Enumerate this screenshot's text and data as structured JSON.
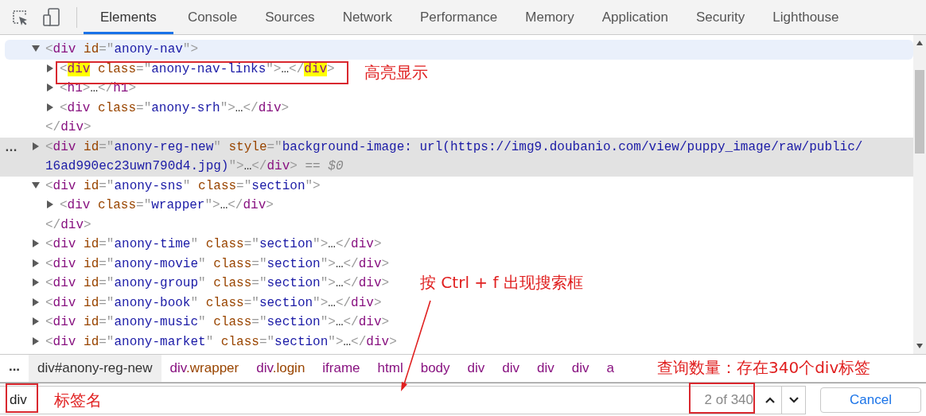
{
  "toolbar": {
    "tabs": [
      {
        "label": "Elements",
        "selected": true
      },
      {
        "label": "Console",
        "selected": false
      },
      {
        "label": "Sources",
        "selected": false
      },
      {
        "label": "Network",
        "selected": false
      },
      {
        "label": "Performance",
        "selected": false
      },
      {
        "label": "Memory",
        "selected": false
      },
      {
        "label": "Application",
        "selected": false
      },
      {
        "label": "Security",
        "selected": false
      },
      {
        "label": "Lighthouse",
        "selected": false
      }
    ]
  },
  "tree": [
    {
      "expanded": true,
      "hovered": true,
      "selected": false,
      "open": [
        {
          "kind": "punct",
          "text": "<"
        },
        {
          "kind": "tag",
          "text": "div"
        },
        {
          "kind": "attr",
          "text": " id"
        },
        {
          "kind": "punct",
          "text": "=\""
        },
        {
          "kind": "value",
          "text": "anony-nav"
        },
        {
          "kind": "punct",
          "text": "\">"
        }
      ],
      "children": [
        {
          "expanded": false,
          "hovered": false,
          "selected": false,
          "open": [
            {
              "kind": "punct",
              "text": "<"
            },
            {
              "kind": "match",
              "text": "div"
            },
            {
              "kind": "attr",
              "text": " class"
            },
            {
              "kind": "punct",
              "text": "=\""
            },
            {
              "kind": "value",
              "text": "anony-nav-links"
            },
            {
              "kind": "punct",
              "text": "\">"
            },
            {
              "kind": "text",
              "text": "…"
            },
            {
              "kind": "punct",
              "text": "</"
            },
            {
              "kind": "match",
              "text": "div"
            },
            {
              "kind": "punct",
              "text": ">"
            }
          ]
        },
        {
          "expanded": false,
          "hovered": false,
          "selected": false,
          "open": [
            {
              "kind": "punct",
              "text": "<"
            },
            {
              "kind": "tag",
              "text": "h1"
            },
            {
              "kind": "punct",
              "text": ">"
            },
            {
              "kind": "text",
              "text": "…"
            },
            {
              "kind": "punct",
              "text": "</"
            },
            {
              "kind": "tag",
              "text": "h1"
            },
            {
              "kind": "punct",
              "text": ">"
            }
          ]
        },
        {
          "expanded": false,
          "hovered": false,
          "selected": false,
          "open": [
            {
              "kind": "punct",
              "text": "<"
            },
            {
              "kind": "tag",
              "text": "div"
            },
            {
              "kind": "attr",
              "text": " class"
            },
            {
              "kind": "punct",
              "text": "=\""
            },
            {
              "kind": "value",
              "text": "anony-srh"
            },
            {
              "kind": "punct",
              "text": "\">"
            },
            {
              "kind": "text",
              "text": "…"
            },
            {
              "kind": "punct",
              "text": "</"
            },
            {
              "kind": "tag",
              "text": "div"
            },
            {
              "kind": "punct",
              "text": ">"
            }
          ]
        }
      ],
      "close": [
        {
          "kind": "punct",
          "text": "</"
        },
        {
          "kind": "tag",
          "text": "div"
        },
        {
          "kind": "punct",
          "text": ">"
        }
      ]
    },
    {
      "expanded": false,
      "hovered": false,
      "selected": true,
      "menu": "…",
      "open": [
        {
          "kind": "punct",
          "text": "<"
        },
        {
          "kind": "tag",
          "text": "div"
        },
        {
          "kind": "attr",
          "text": " id"
        },
        {
          "kind": "punct",
          "text": "=\""
        },
        {
          "kind": "value",
          "text": "anony-reg-new"
        },
        {
          "kind": "punct",
          "text": "\""
        },
        {
          "kind": "attr",
          "text": " style"
        },
        {
          "kind": "punct",
          "text": "=\""
        },
        {
          "kind": "value",
          "text": "background-image: url(https://img9.doubanio.com/view/puppy_image/raw/public/16ad990ec23uwn790d4.jpg)"
        },
        {
          "kind": "punct",
          "text": "\">"
        },
        {
          "kind": "text",
          "text": "…"
        },
        {
          "kind": "punct",
          "text": "</"
        },
        {
          "kind": "tag",
          "text": "div"
        },
        {
          "kind": "punct",
          "text": ">"
        },
        {
          "kind": "dim",
          "text": " == $0"
        }
      ]
    },
    {
      "expanded": true,
      "hovered": false,
      "selected": false,
      "open": [
        {
          "kind": "punct",
          "text": "<"
        },
        {
          "kind": "tag",
          "text": "div"
        },
        {
          "kind": "attr",
          "text": " id"
        },
        {
          "kind": "punct",
          "text": "=\""
        },
        {
          "kind": "value",
          "text": "anony-sns"
        },
        {
          "kind": "punct",
          "text": "\""
        },
        {
          "kind": "attr",
          "text": " class"
        },
        {
          "kind": "punct",
          "text": "=\""
        },
        {
          "kind": "value",
          "text": "section"
        },
        {
          "kind": "punct",
          "text": "\">"
        }
      ],
      "children": [
        {
          "expanded": false,
          "hovered": false,
          "selected": false,
          "open": [
            {
              "kind": "punct",
              "text": "<"
            },
            {
              "kind": "tag",
              "text": "div"
            },
            {
              "kind": "attr",
              "text": " class"
            },
            {
              "kind": "punct",
              "text": "=\""
            },
            {
              "kind": "value",
              "text": "wrapper"
            },
            {
              "kind": "punct",
              "text": "\">"
            },
            {
              "kind": "text",
              "text": "…"
            },
            {
              "kind": "punct",
              "text": "</"
            },
            {
              "kind": "tag",
              "text": "div"
            },
            {
              "kind": "punct",
              "text": ">"
            }
          ]
        }
      ],
      "close": [
        {
          "kind": "punct",
          "text": "</"
        },
        {
          "kind": "tag",
          "text": "div"
        },
        {
          "kind": "punct",
          "text": ">"
        }
      ]
    },
    {
      "expanded": false,
      "hovered": false,
      "selected": false,
      "open": [
        {
          "kind": "punct",
          "text": "<"
        },
        {
          "kind": "tag",
          "text": "div"
        },
        {
          "kind": "attr",
          "text": " id"
        },
        {
          "kind": "punct",
          "text": "=\""
        },
        {
          "kind": "value",
          "text": "anony-time"
        },
        {
          "kind": "punct",
          "text": "\""
        },
        {
          "kind": "attr",
          "text": " class"
        },
        {
          "kind": "punct",
          "text": "=\""
        },
        {
          "kind": "value",
          "text": "section"
        },
        {
          "kind": "punct",
          "text": "\">"
        },
        {
          "kind": "text",
          "text": "…"
        },
        {
          "kind": "punct",
          "text": "</"
        },
        {
          "kind": "tag",
          "text": "div"
        },
        {
          "kind": "punct",
          "text": ">"
        }
      ]
    },
    {
      "expanded": false,
      "hovered": false,
      "selected": false,
      "open": [
        {
          "kind": "punct",
          "text": "<"
        },
        {
          "kind": "tag",
          "text": "div"
        },
        {
          "kind": "attr",
          "text": " id"
        },
        {
          "kind": "punct",
          "text": "=\""
        },
        {
          "kind": "value",
          "text": "anony-movie"
        },
        {
          "kind": "punct",
          "text": "\""
        },
        {
          "kind": "attr",
          "text": " class"
        },
        {
          "kind": "punct",
          "text": "=\""
        },
        {
          "kind": "value",
          "text": "section"
        },
        {
          "kind": "punct",
          "text": "\">"
        },
        {
          "kind": "text",
          "text": "…"
        },
        {
          "kind": "punct",
          "text": "</"
        },
        {
          "kind": "tag",
          "text": "div"
        },
        {
          "kind": "punct",
          "text": ">"
        }
      ]
    },
    {
      "expanded": false,
      "hovered": false,
      "selected": false,
      "open": [
        {
          "kind": "punct",
          "text": "<"
        },
        {
          "kind": "tag",
          "text": "div"
        },
        {
          "kind": "attr",
          "text": " id"
        },
        {
          "kind": "punct",
          "text": "=\""
        },
        {
          "kind": "value",
          "text": "anony-group"
        },
        {
          "kind": "punct",
          "text": "\""
        },
        {
          "kind": "attr",
          "text": " class"
        },
        {
          "kind": "punct",
          "text": "=\""
        },
        {
          "kind": "value",
          "text": "section"
        },
        {
          "kind": "punct",
          "text": "\">"
        },
        {
          "kind": "text",
          "text": "…"
        },
        {
          "kind": "punct",
          "text": "</"
        },
        {
          "kind": "tag",
          "text": "div"
        },
        {
          "kind": "punct",
          "text": ">"
        }
      ]
    },
    {
      "expanded": false,
      "hovered": false,
      "selected": false,
      "open": [
        {
          "kind": "punct",
          "text": "<"
        },
        {
          "kind": "tag",
          "text": "div"
        },
        {
          "kind": "attr",
          "text": " id"
        },
        {
          "kind": "punct",
          "text": "=\""
        },
        {
          "kind": "value",
          "text": "anony-book"
        },
        {
          "kind": "punct",
          "text": "\""
        },
        {
          "kind": "attr",
          "text": " class"
        },
        {
          "kind": "punct",
          "text": "=\""
        },
        {
          "kind": "value",
          "text": "section"
        },
        {
          "kind": "punct",
          "text": "\">"
        },
        {
          "kind": "text",
          "text": "…"
        },
        {
          "kind": "punct",
          "text": "</"
        },
        {
          "kind": "tag",
          "text": "div"
        },
        {
          "kind": "punct",
          "text": ">"
        }
      ]
    },
    {
      "expanded": false,
      "hovered": false,
      "selected": false,
      "open": [
        {
          "kind": "punct",
          "text": "<"
        },
        {
          "kind": "tag",
          "text": "div"
        },
        {
          "kind": "attr",
          "text": " id"
        },
        {
          "kind": "punct",
          "text": "=\""
        },
        {
          "kind": "value",
          "text": "anony-music"
        },
        {
          "kind": "punct",
          "text": "\""
        },
        {
          "kind": "attr",
          "text": " class"
        },
        {
          "kind": "punct",
          "text": "=\""
        },
        {
          "kind": "value",
          "text": "section"
        },
        {
          "kind": "punct",
          "text": "\">"
        },
        {
          "kind": "text",
          "text": "…"
        },
        {
          "kind": "punct",
          "text": "</"
        },
        {
          "kind": "tag",
          "text": "div"
        },
        {
          "kind": "punct",
          "text": ">"
        }
      ]
    },
    {
      "expanded": false,
      "hovered": false,
      "selected": false,
      "open": [
        {
          "kind": "punct",
          "text": "<"
        },
        {
          "kind": "tag",
          "text": "div"
        },
        {
          "kind": "attr",
          "text": " id"
        },
        {
          "kind": "punct",
          "text": "=\""
        },
        {
          "kind": "value",
          "text": "anony-market"
        },
        {
          "kind": "punct",
          "text": "\""
        },
        {
          "kind": "attr",
          "text": " class"
        },
        {
          "kind": "punct",
          "text": "=\""
        },
        {
          "kind": "value",
          "text": "section"
        },
        {
          "kind": "punct",
          "text": "\">"
        },
        {
          "kind": "text",
          "text": "…"
        },
        {
          "kind": "punct",
          "text": "</"
        },
        {
          "kind": "tag",
          "text": "div"
        },
        {
          "kind": "punct",
          "text": ">"
        }
      ]
    }
  ],
  "breadcrumbs": {
    "more": "...",
    "items": [
      {
        "tag": "div",
        "rest": "#anony-reg-new",
        "selected": true
      },
      {
        "tag": "div",
        "rest": ".wrapper",
        "selected": false
      },
      {
        "tag": "div",
        "rest": ".login",
        "selected": false
      },
      {
        "tag": "iframe",
        "selected": false
      },
      {
        "tag": "html",
        "selected": false
      },
      {
        "tag": "body",
        "selected": false
      },
      {
        "tag": "div",
        "selected": false
      },
      {
        "tag": "div",
        "selected": false
      },
      {
        "tag": "div",
        "selected": false
      },
      {
        "tag": "div",
        "selected": false
      },
      {
        "tag": "a",
        "selected": false
      }
    ]
  },
  "search": {
    "value": "div",
    "count": "2 of 340",
    "cancel": "Cancel"
  },
  "annotations": [
    {
      "kind": "box"
    },
    {
      "kind": "note",
      "text": "高亮显示"
    },
    {
      "kind": "note",
      "text": "按 Ctrl + f 出现搜索框"
    },
    {
      "kind": "arrow"
    },
    {
      "kind": "note",
      "text": "查询数量：存在340个div标签"
    },
    {
      "kind": "box"
    },
    {
      "kind": "note",
      "text": "标签名"
    },
    {
      "kind": "box"
    }
  ]
}
